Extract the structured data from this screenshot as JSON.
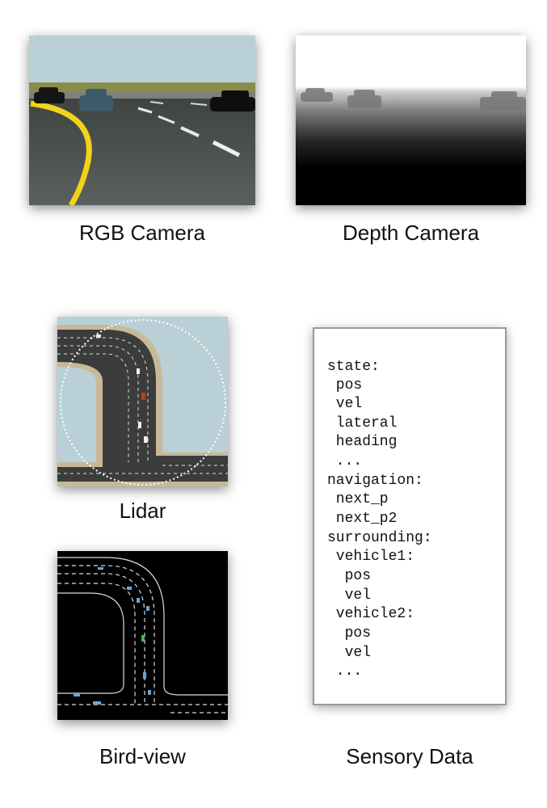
{
  "panels": {
    "rgb_camera": {
      "label": "RGB Camera"
    },
    "depth_camera": {
      "label": "Depth Camera"
    },
    "lidar": {
      "label": "Lidar"
    },
    "bird_view": {
      "label": "Bird-view"
    },
    "sensory_data": {
      "label": "Sensory Data"
    }
  },
  "sensory_lines": [
    "state:",
    " pos",
    " vel",
    " lateral",
    " heading",
    " ...",
    "navigation:",
    " next_p",
    " next_p2",
    "surrounding:",
    " vehicle1:",
    "  pos",
    "  vel",
    " vehicle2:",
    "  pos",
    "  vel",
    " ..."
  ],
  "colors": {
    "sky": "#b8d0d6",
    "grass": "#8a8c4e",
    "road": "#4f5552",
    "lane_yellow": "#f2d21a",
    "lidar_bg": "#b8d0d6",
    "bird_bg": "#000000",
    "vehicle_blue": "#6aa6d8"
  }
}
